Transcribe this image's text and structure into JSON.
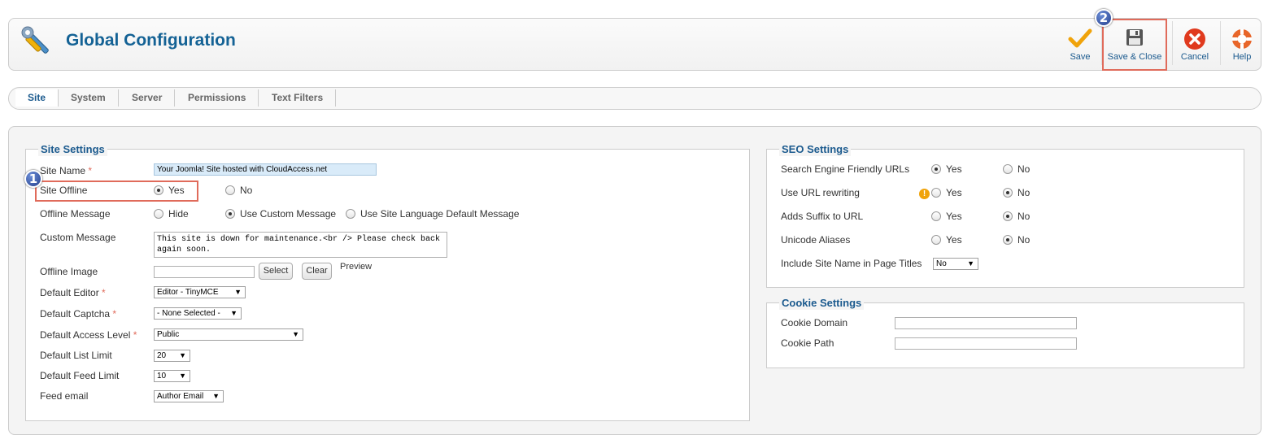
{
  "header": {
    "title": "Global Configuration",
    "buttons": {
      "save": "Save",
      "save_close": "Save & Close",
      "cancel": "Cancel",
      "help": "Help"
    },
    "step_badges": [
      "1",
      "2"
    ]
  },
  "tabs": [
    "Site",
    "System",
    "Server",
    "Permissions",
    "Text Filters"
  ],
  "active_tab": "Site",
  "site_settings": {
    "legend": "Site Settings",
    "site_name_label": "Site Name",
    "site_name_value": "Your Joomla! Site hosted with CloudAccess.net",
    "site_offline_label": "Site Offline",
    "site_offline_yes": "Yes",
    "site_offline_no": "No",
    "offline_message_label": "Offline Message",
    "offline_message_options": [
      "Hide",
      "Use Custom Message",
      "Use Site Language Default Message"
    ],
    "custom_message_label": "Custom Message",
    "custom_message_value": "This site is down for maintenance.<br /> Please check back again soon.",
    "offline_image_label": "Offline Image",
    "offline_image_value": "",
    "select_button": "Select",
    "clear_button": "Clear",
    "preview_label": "Preview",
    "default_editor_label": "Default Editor",
    "default_editor_value": "Editor - TinyMCE",
    "default_captcha_label": "Default Captcha",
    "default_captcha_value": "- None Selected -",
    "default_access_label": "Default Access Level",
    "default_access_value": "Public",
    "default_list_limit_label": "Default List Limit",
    "default_list_limit_value": "20",
    "default_feed_limit_label": "Default Feed Limit",
    "default_feed_limit_value": "10",
    "feed_email_label": "Feed email",
    "feed_email_value": "Author Email",
    "required_marker": "*"
  },
  "seo_settings": {
    "legend": "SEO Settings",
    "rows": [
      {
        "label": "Search Engine Friendly URLs",
        "selected": "yes"
      },
      {
        "label": "Use URL rewriting",
        "selected": "no"
      },
      {
        "label": "Adds Suffix to URL",
        "selected": "no"
      },
      {
        "label": "Unicode Aliases",
        "selected": "no"
      }
    ],
    "yes": "Yes",
    "no": "No",
    "warning_glyph": "!",
    "site_name_titles_label": "Include Site Name in Page Titles",
    "site_name_titles_value": "No"
  },
  "cookie_settings": {
    "legend": "Cookie Settings",
    "domain_label": "Cookie Domain",
    "domain_value": "",
    "path_label": "Cookie Path",
    "path_value": ""
  },
  "colors": {
    "accent": "#146295",
    "highlight": "#e06b5b",
    "save_check": "#f0a30a",
    "cancel": "#e03a1e"
  },
  "icons": [
    "tools-icon",
    "checkmark-icon",
    "floppy-disk-icon",
    "cancel-icon",
    "lifebuoy-icon",
    "warning-icon",
    "chevron-down-icon"
  ]
}
